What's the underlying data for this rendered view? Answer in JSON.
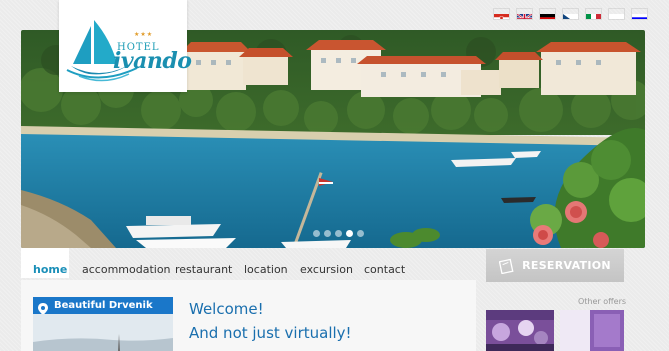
{
  "logo": {
    "stars": "★★★",
    "hotel_label": "HOTEL",
    "name": "ivando"
  },
  "languages": [
    {
      "name": "croatian-flag"
    },
    {
      "name": "english-flag"
    },
    {
      "name": "german-flag"
    },
    {
      "name": "czech-flag"
    },
    {
      "name": "italian-flag"
    },
    {
      "name": "polish-flag"
    },
    {
      "name": "slovenian-flag"
    }
  ],
  "slider": {
    "total_slides": 5,
    "active_slide": 4
  },
  "nav": {
    "items": [
      {
        "label": "home",
        "active": true
      },
      {
        "label": "accommodation"
      },
      {
        "label": "restaurant"
      },
      {
        "label": "location"
      },
      {
        "label": "excursion"
      },
      {
        "label": "contact"
      }
    ]
  },
  "reservation": {
    "label": "RESERVATION"
  },
  "sidebar": {
    "title": "Beautiful Drvenik"
  },
  "main": {
    "welcome_line1": "Welcome!",
    "welcome_line2": "And not just virtually!"
  },
  "offers": {
    "label": "Other offers"
  },
  "colors": {
    "accent": "#1a8fb8",
    "sidebar_head": "#1a77c9",
    "reservation_bg": "#c9c9c9",
    "sea": "#1b7fa8"
  }
}
